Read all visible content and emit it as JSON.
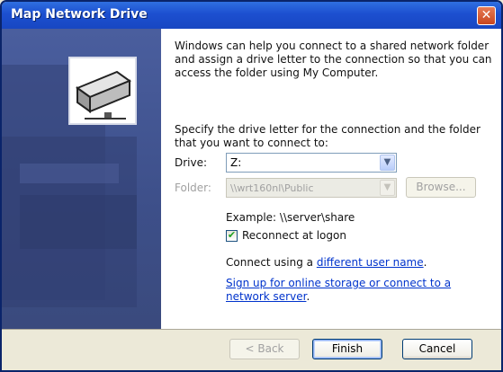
{
  "window": {
    "title": "Map Network Drive",
    "close_label": "✕"
  },
  "content": {
    "intro": "Windows can help you connect to a shared network folder and assign a drive letter to the connection so that you can access the folder using My Computer.",
    "instructions": "Specify the drive letter for the connection and the folder that you want to connect to:",
    "drive": {
      "label": "Drive:",
      "value": "Z:"
    },
    "folder": {
      "label": "Folder:",
      "value": "\\\\wrt160nl\\Public",
      "browse_label": "Browse..."
    },
    "example": "Example: \\\\server\\share",
    "reconnect": {
      "label": "Reconnect at logon",
      "checked": true,
      "check_glyph": "✔"
    },
    "connect_prefix": "Connect using a ",
    "connect_link": "different user name",
    "connect_suffix": ".",
    "signup_link": "Sign up for online storage or connect to a network server",
    "signup_suffix": "."
  },
  "footer": {
    "back_label": "< Back",
    "finish_label": "Finish",
    "cancel_label": "Cancel"
  },
  "icons": {
    "dropdown": "▼"
  },
  "colors": {
    "titlebar": "#1c4fd0",
    "left_panel": "#3d4f89",
    "link": "#0033cc",
    "close": "#c8461f"
  }
}
